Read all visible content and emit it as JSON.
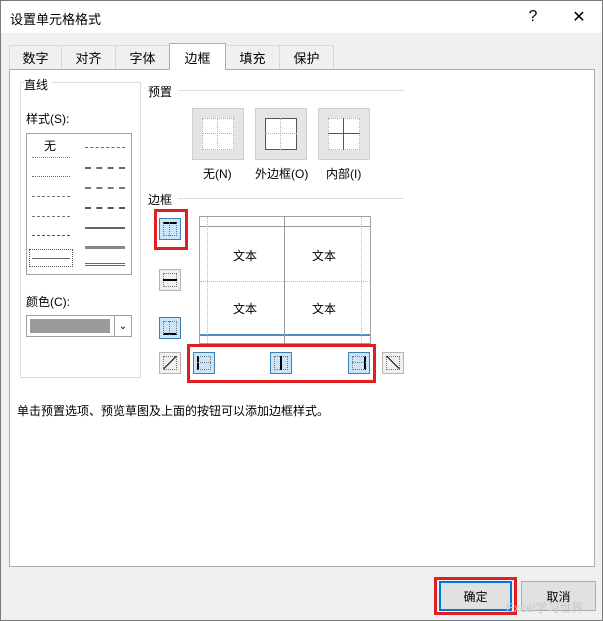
{
  "window": {
    "title": "设置单元格格式",
    "help_icon": "?",
    "close_icon": "✕"
  },
  "tabs": [
    {
      "label": "数字"
    },
    {
      "label": "对齐"
    },
    {
      "label": "字体"
    },
    {
      "label": "边框"
    },
    {
      "label": "填充"
    },
    {
      "label": "保护"
    }
  ],
  "active_tab": "边框",
  "line": {
    "group_label": "直线",
    "style_label": "样式(S):",
    "none_label": "无",
    "color_label": "颜色(C):",
    "color_value": "#9b9b9b"
  },
  "presets": {
    "group_label": "预置",
    "items": [
      {
        "label": "无(N)"
      },
      {
        "label": "外边框(O)"
      },
      {
        "label": "内部(I)"
      }
    ]
  },
  "border": {
    "group_label": "边框",
    "preview_cells": [
      "文本",
      "文本",
      "文本",
      "文本"
    ]
  },
  "hint": "单击预置选项、预览草图及上面的按钮可以添加边框样式。",
  "buttons": {
    "ok": "确定",
    "cancel": "取消"
  },
  "watermark": "Excel学习世界",
  "colors": {
    "highlight_red": "#e02020",
    "selected_blue": "#cce4f7",
    "accent": "#0078d7"
  }
}
